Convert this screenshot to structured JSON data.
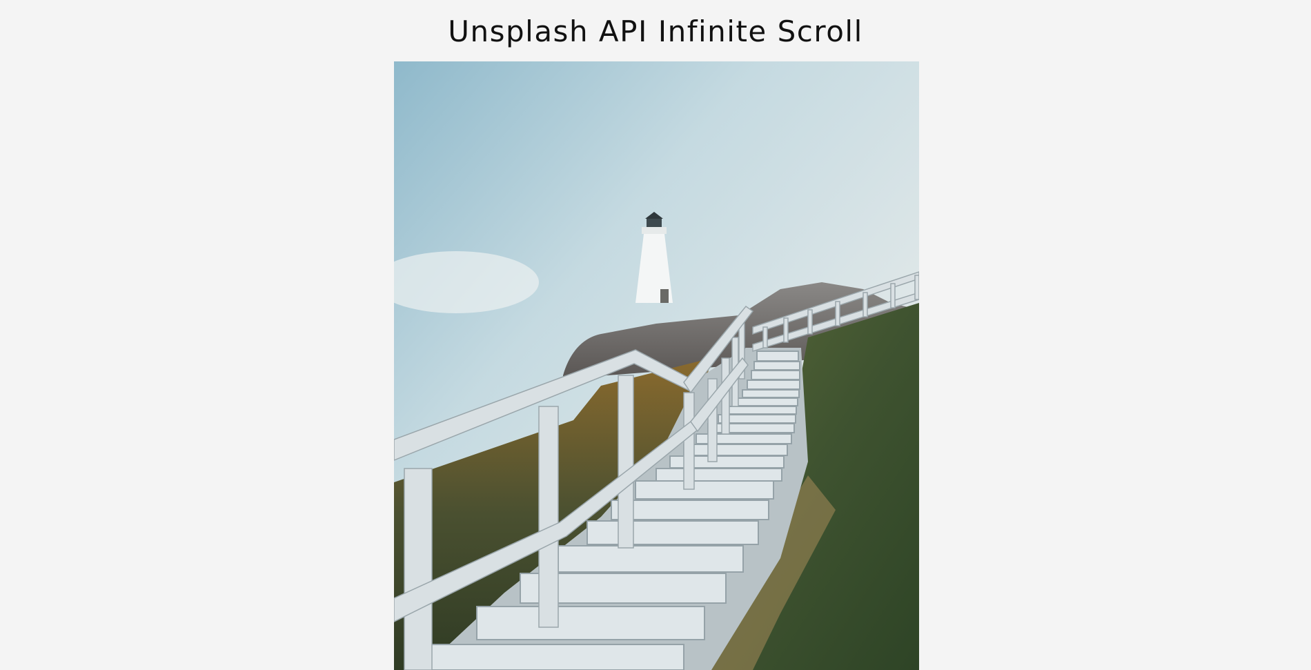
{
  "header": {
    "title": "Unsplash API Infinite Scroll"
  },
  "gallery": {
    "images": [
      {
        "icon": "photo-lighthouse-stairs"
      }
    ]
  },
  "colors": {
    "background": "#f4f4f4",
    "title_text": "#111111"
  }
}
